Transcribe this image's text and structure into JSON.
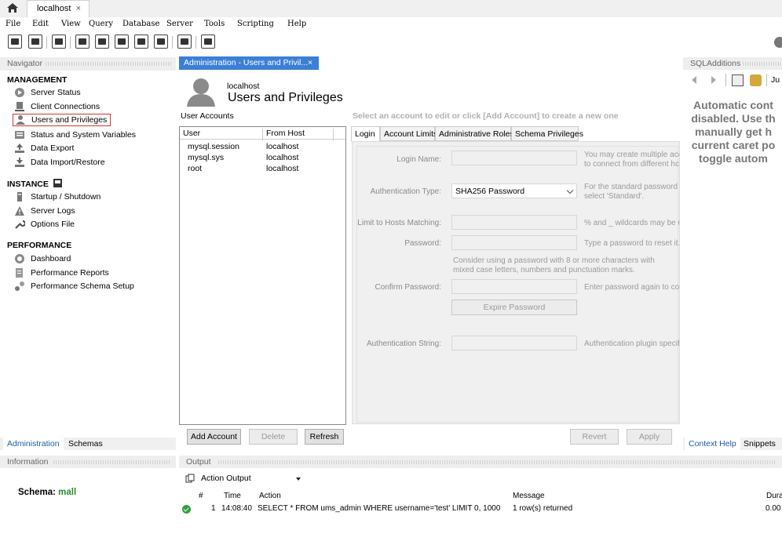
{
  "app": {
    "connection_tab": "localhost",
    "close_glyph": "×"
  },
  "menu": [
    "File",
    "Edit",
    "View",
    "Query",
    "Database",
    "Server",
    "Tools",
    "Scripting",
    "Help"
  ],
  "navigator": {
    "header": "Navigator",
    "sections": [
      {
        "title": "MANAGEMENT",
        "items": [
          "Server Status",
          "Client Connections",
          "Users and Privileges",
          "Status and System Variables",
          "Data Export",
          "Data Import/Restore"
        ]
      },
      {
        "title": "INSTANCE",
        "items": [
          "Startup / Shutdown",
          "Server Logs",
          "Options File"
        ]
      },
      {
        "title": "PERFORMANCE",
        "items": [
          "Dashboard",
          "Performance Reports",
          "Performance Schema Setup"
        ]
      }
    ],
    "selected_item": "Users and Privileges",
    "tabs": [
      "Administration",
      "Schemas"
    ]
  },
  "information": {
    "header": "Information",
    "schema_label": "Schema:",
    "schema_value": "mall"
  },
  "main_tab": {
    "label": "Administration - Users and Privil..."
  },
  "users": {
    "host": "localhost",
    "title": "Users and Privileges",
    "accounts_label": "User Accounts",
    "columns": [
      "User",
      "From Host"
    ],
    "rows": [
      {
        "user": "mysql.session",
        "host": "localhost"
      },
      {
        "user": "mysql.sys",
        "host": "localhost"
      },
      {
        "user": "root",
        "host": "localhost"
      }
    ],
    "buttons": {
      "add": "Add Account",
      "delete": "Delete",
      "refresh": "Refresh",
      "revert": "Revert",
      "apply": "Apply"
    },
    "hint": "Select an account to edit or click [Add Account] to create a new one",
    "tabs": [
      "Login",
      "Account Limits",
      "Administrative Roles",
      "Schema Privileges"
    ],
    "active_tab": "Login",
    "form": {
      "login_name_label": "Login Name:",
      "login_name_hint": "You may create multiple acco",
      "login_name_hint2": "to connect from different hc",
      "auth_type_label": "Authentication Type:",
      "auth_type_value": "SHA256 Password",
      "auth_type_hint": "For the standard password a",
      "auth_type_hint2": "select 'Standard'.",
      "limit_hosts_label": "Limit to Hosts Matching:",
      "limit_hosts_hint": "% and _ wildcards may be u",
      "password_label": "Password:",
      "password_hint": "Type a password to reset it.",
      "password_advice1": "Consider using a password with 8 or more characters with",
      "password_advice2": "mixed case letters, numbers and punctuation marks.",
      "confirm_label": "Confirm Password:",
      "confirm_hint": "Enter password again to cor",
      "expire_button": "Expire Password",
      "auth_string_label": "Authentication String:",
      "auth_string_hint": "Authentication plugin specifi"
    }
  },
  "sql_additions": {
    "header": "SQLAdditions",
    "jump": "Ju",
    "text_lines": [
      "Automatic cont",
      "disabled. Use th",
      "manually get h",
      "current caret po",
      "toggle autom"
    ],
    "tabs": [
      "Context Help",
      "Snippets"
    ]
  },
  "output": {
    "header": "Output",
    "mode": "Action Output",
    "columns": [
      "#",
      "Time",
      "Action",
      "Message",
      "Dura"
    ],
    "rows": [
      {
        "num": "1",
        "time": "14:08:40",
        "action": "SELECT * FROM ums_admin WHERE username='test' LIMIT 0, 1000",
        "message": "1 row(s) returned",
        "duration": "0.00"
      }
    ]
  }
}
